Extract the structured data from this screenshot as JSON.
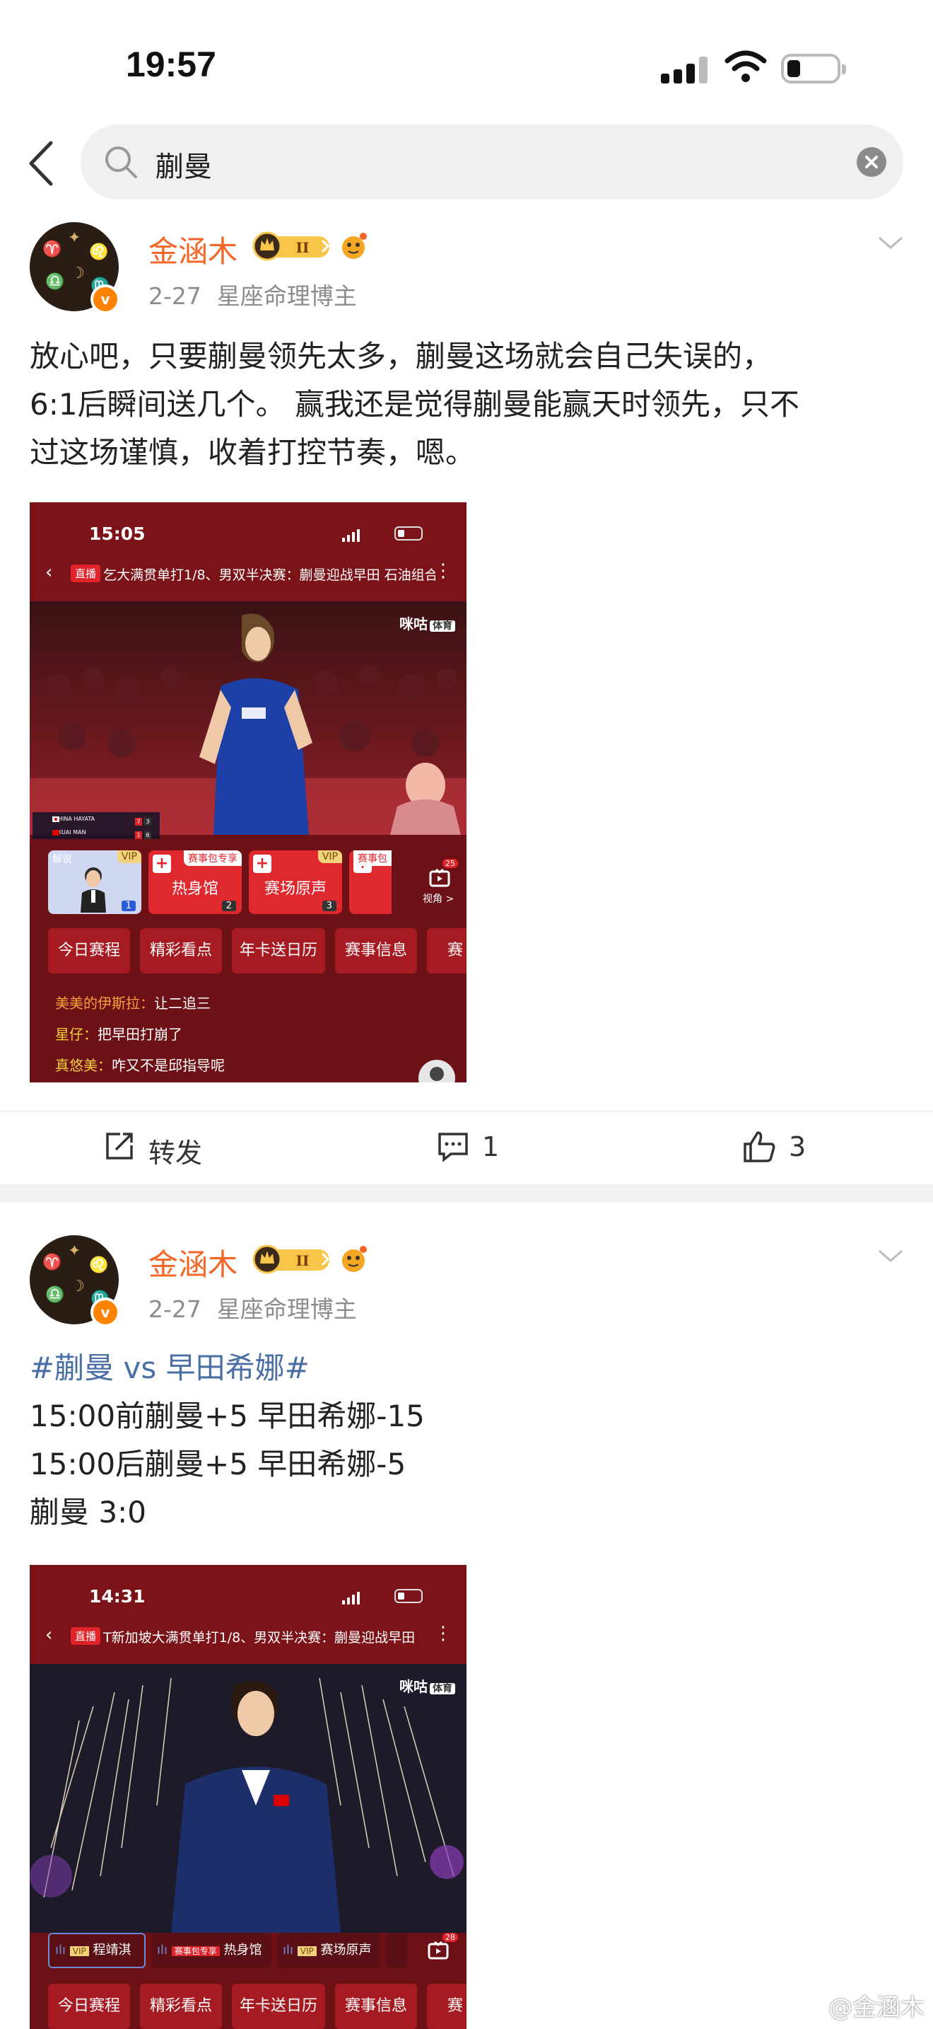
{
  "status_bar": {
    "time": "19:57"
  },
  "search": {
    "query": "蒯曼"
  },
  "colors": {
    "username": "#f26522",
    "hashtag": "#4a6fa5",
    "verified_badge": "#ff8200"
  },
  "posts": [
    {
      "username": "金涵木",
      "level_badge": "II",
      "date": "2-27",
      "source": "星座命理博主",
      "text_lines": [
        "放心吧，只要蒯曼领先太多，蒯曼这场就会自己失误的，",
        "6:1后瞬间送几个。 赢我还是觉得蒯曼能赢天时领先，只不",
        "过这场谨慎，收着打控节奏，嗯。"
      ],
      "image": {
        "time": "15:05",
        "live_label": "直播",
        "title": "乞大满贯单打1/8、男双半决赛：蒯曼迎战早田 石油组合",
        "brand": "咪咕",
        "brand_tag": "体育",
        "scoreboard": [
          {
            "name": "HINA HAYATA",
            "scores": [
              "7",
              "3"
            ]
          },
          {
            "name": "KUAI MAN",
            "scores": [
              "1",
              "6"
            ]
          }
        ],
        "cards": [
          {
            "tag": "VIP",
            "label": "解说",
            "num": "1"
          },
          {
            "tag": "赛事包专享",
            "label": "热身馆",
            "num": "2"
          },
          {
            "tag": "VIP",
            "label": "赛场原声",
            "num": "3"
          },
          {
            "tag": "赛事包",
            "label": "",
            "num": ""
          }
        ],
        "view_label": "视角 >",
        "view_count": "25",
        "chips": [
          "今日赛程",
          "精彩看点",
          "年卡送日历",
          "赛事信息",
          "赛"
        ],
        "chat": [
          {
            "user": "美美的伊斯拉：",
            "msg": "让二追三"
          },
          {
            "user": "星仔：",
            "msg": "把早田打崩了"
          },
          {
            "user": "真悠美：",
            "msg": "咋又不是邱指导呢"
          }
        ]
      },
      "actions": {
        "repost": "转发",
        "comments": "1",
        "likes": "3"
      }
    },
    {
      "username": "金涵木",
      "level_badge": "II",
      "date": "2-27",
      "source": "星座命理博主",
      "hashtag": "#蒯曼 vs 早田希娜#",
      "text_lines": [
        "15:00前蒯曼+5 早田希娜-15",
        "15:00后蒯曼+5 早田希娜-5",
        "蒯曼 3:0"
      ],
      "image": {
        "time": "14:31",
        "live_label": "直播",
        "title": "T新加坡大满贯单打1/8、男双半决赛：蒯曼迎战早田",
        "brand": "咪咕",
        "brand_tag": "体育",
        "tabs": [
          {
            "tag": "VIP",
            "label": "程靖淇"
          },
          {
            "tag": "赛事包专享",
            "label": "热身馆"
          },
          {
            "tag": "VIP",
            "label": "赛场原声"
          }
        ],
        "view_count": "28",
        "chips": [
          "今日赛程",
          "精彩看点",
          "年卡送日历",
          "赛事信息",
          "赛"
        ]
      }
    }
  ],
  "watermark": "@金涵木"
}
